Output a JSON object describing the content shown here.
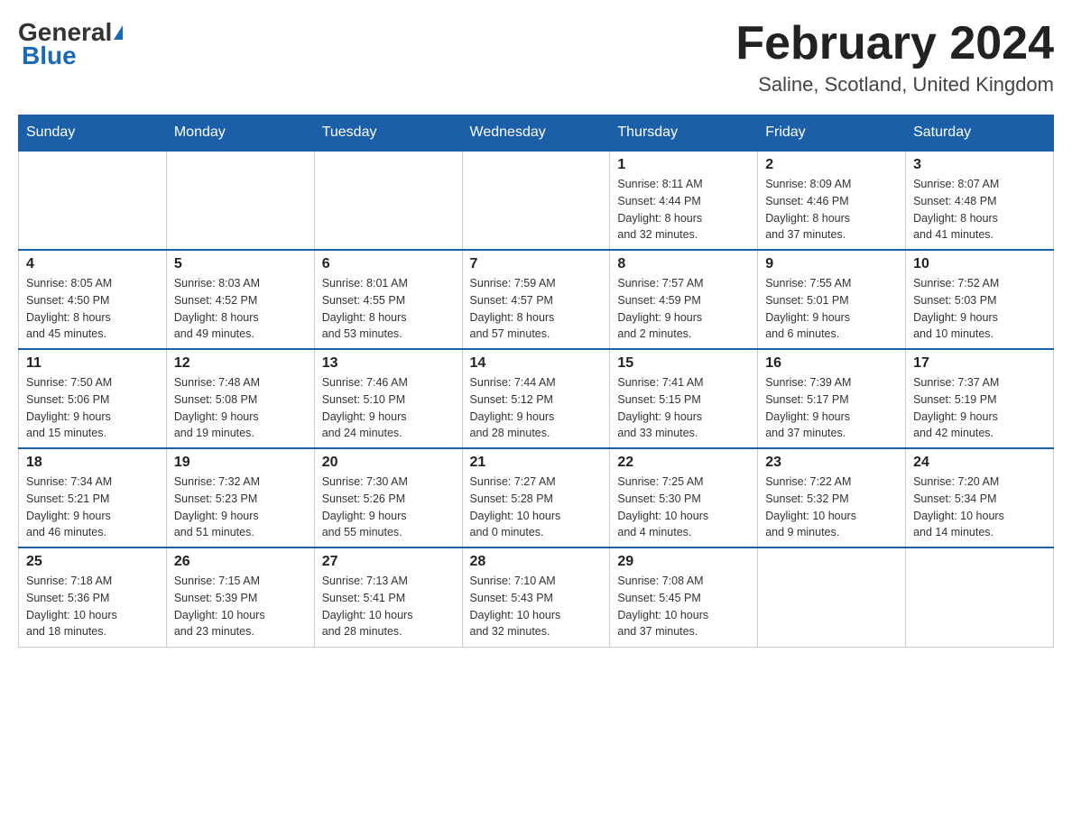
{
  "header": {
    "logo": {
      "general": "General",
      "blue": "Blue",
      "triangle_label": "logo-triangle"
    },
    "title": "February 2024",
    "subtitle": "Saline, Scotland, United Kingdom"
  },
  "weekdays": [
    "Sunday",
    "Monday",
    "Tuesday",
    "Wednesday",
    "Thursday",
    "Friday",
    "Saturday"
  ],
  "weeks": [
    [
      {
        "day": "",
        "info": ""
      },
      {
        "day": "",
        "info": ""
      },
      {
        "day": "",
        "info": ""
      },
      {
        "day": "",
        "info": ""
      },
      {
        "day": "1",
        "info": "Sunrise: 8:11 AM\nSunset: 4:44 PM\nDaylight: 8 hours\nand 32 minutes."
      },
      {
        "day": "2",
        "info": "Sunrise: 8:09 AM\nSunset: 4:46 PM\nDaylight: 8 hours\nand 37 minutes."
      },
      {
        "day": "3",
        "info": "Sunrise: 8:07 AM\nSunset: 4:48 PM\nDaylight: 8 hours\nand 41 minutes."
      }
    ],
    [
      {
        "day": "4",
        "info": "Sunrise: 8:05 AM\nSunset: 4:50 PM\nDaylight: 8 hours\nand 45 minutes."
      },
      {
        "day": "5",
        "info": "Sunrise: 8:03 AM\nSunset: 4:52 PM\nDaylight: 8 hours\nand 49 minutes."
      },
      {
        "day": "6",
        "info": "Sunrise: 8:01 AM\nSunset: 4:55 PM\nDaylight: 8 hours\nand 53 minutes."
      },
      {
        "day": "7",
        "info": "Sunrise: 7:59 AM\nSunset: 4:57 PM\nDaylight: 8 hours\nand 57 minutes."
      },
      {
        "day": "8",
        "info": "Sunrise: 7:57 AM\nSunset: 4:59 PM\nDaylight: 9 hours\nand 2 minutes."
      },
      {
        "day": "9",
        "info": "Sunrise: 7:55 AM\nSunset: 5:01 PM\nDaylight: 9 hours\nand 6 minutes."
      },
      {
        "day": "10",
        "info": "Sunrise: 7:52 AM\nSunset: 5:03 PM\nDaylight: 9 hours\nand 10 minutes."
      }
    ],
    [
      {
        "day": "11",
        "info": "Sunrise: 7:50 AM\nSunset: 5:06 PM\nDaylight: 9 hours\nand 15 minutes."
      },
      {
        "day": "12",
        "info": "Sunrise: 7:48 AM\nSunset: 5:08 PM\nDaylight: 9 hours\nand 19 minutes."
      },
      {
        "day": "13",
        "info": "Sunrise: 7:46 AM\nSunset: 5:10 PM\nDaylight: 9 hours\nand 24 minutes."
      },
      {
        "day": "14",
        "info": "Sunrise: 7:44 AM\nSunset: 5:12 PM\nDaylight: 9 hours\nand 28 minutes."
      },
      {
        "day": "15",
        "info": "Sunrise: 7:41 AM\nSunset: 5:15 PM\nDaylight: 9 hours\nand 33 minutes."
      },
      {
        "day": "16",
        "info": "Sunrise: 7:39 AM\nSunset: 5:17 PM\nDaylight: 9 hours\nand 37 minutes."
      },
      {
        "day": "17",
        "info": "Sunrise: 7:37 AM\nSunset: 5:19 PM\nDaylight: 9 hours\nand 42 minutes."
      }
    ],
    [
      {
        "day": "18",
        "info": "Sunrise: 7:34 AM\nSunset: 5:21 PM\nDaylight: 9 hours\nand 46 minutes."
      },
      {
        "day": "19",
        "info": "Sunrise: 7:32 AM\nSunset: 5:23 PM\nDaylight: 9 hours\nand 51 minutes."
      },
      {
        "day": "20",
        "info": "Sunrise: 7:30 AM\nSunset: 5:26 PM\nDaylight: 9 hours\nand 55 minutes."
      },
      {
        "day": "21",
        "info": "Sunrise: 7:27 AM\nSunset: 5:28 PM\nDaylight: 10 hours\nand 0 minutes."
      },
      {
        "day": "22",
        "info": "Sunrise: 7:25 AM\nSunset: 5:30 PM\nDaylight: 10 hours\nand 4 minutes."
      },
      {
        "day": "23",
        "info": "Sunrise: 7:22 AM\nSunset: 5:32 PM\nDaylight: 10 hours\nand 9 minutes."
      },
      {
        "day": "24",
        "info": "Sunrise: 7:20 AM\nSunset: 5:34 PM\nDaylight: 10 hours\nand 14 minutes."
      }
    ],
    [
      {
        "day": "25",
        "info": "Sunrise: 7:18 AM\nSunset: 5:36 PM\nDaylight: 10 hours\nand 18 minutes."
      },
      {
        "day": "26",
        "info": "Sunrise: 7:15 AM\nSunset: 5:39 PM\nDaylight: 10 hours\nand 23 minutes."
      },
      {
        "day": "27",
        "info": "Sunrise: 7:13 AM\nSunset: 5:41 PM\nDaylight: 10 hours\nand 28 minutes."
      },
      {
        "day": "28",
        "info": "Sunrise: 7:10 AM\nSunset: 5:43 PM\nDaylight: 10 hours\nand 32 minutes."
      },
      {
        "day": "29",
        "info": "Sunrise: 7:08 AM\nSunset: 5:45 PM\nDaylight: 10 hours\nand 37 minutes."
      },
      {
        "day": "",
        "info": ""
      },
      {
        "day": "",
        "info": ""
      }
    ]
  ]
}
